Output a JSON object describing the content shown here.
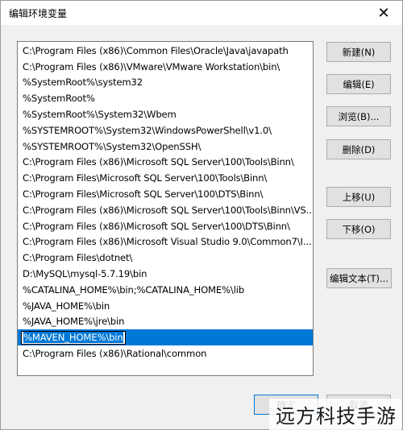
{
  "window": {
    "title": "编辑环境变量",
    "close_glyph": "✕"
  },
  "paths": [
    "C:\\Program Files (x86)\\Common Files\\Oracle\\Java\\javapath",
    "C:\\Program Files (x86)\\VMware\\VMware Workstation\\bin\\",
    "%SystemRoot%\\system32",
    "%SystemRoot%",
    "%SystemRoot%\\System32\\Wbem",
    "%SYSTEMROOT%\\System32\\WindowsPowerShell\\v1.0\\",
    "%SYSTEMROOT%\\System32\\OpenSSH\\",
    "C:\\Program Files (x86)\\Microsoft SQL Server\\100\\Tools\\Binn\\",
    "C:\\Program Files\\Microsoft SQL Server\\100\\Tools\\Binn\\",
    "C:\\Program Files\\Microsoft SQL Server\\100\\DTS\\Binn\\",
    "C:\\Program Files (x86)\\Microsoft SQL Server\\100\\Tools\\Binn\\VS...",
    "C:\\Program Files (x86)\\Microsoft SQL Server\\100\\DTS\\Binn\\",
    "C:\\Program Files (x86)\\Microsoft Visual Studio 9.0\\Common7\\I...",
    "C:\\Program Files\\dotnet\\",
    "D:\\MySQL\\mysql-5.7.19\\bin",
    "%CATALINA_HOME%\\bin;%CATALINA_HOME%\\lib",
    "%JAVA_HOME%\\bin",
    "%JAVA_HOME%\\jre\\bin",
    "%MAVEN_HOME%\\bin",
    "C:\\Program Files (x86)\\Rational\\common"
  ],
  "selected_index": 18,
  "buttons": {
    "new": "新建(N)",
    "edit": "编辑(E)",
    "browse": "浏览(B)...",
    "delete": "删除(D)",
    "move_up": "上移(U)",
    "move_down": "下移(O)",
    "edit_text": "编辑文本(T)..."
  },
  "footer": {
    "ok": "确定",
    "cancel": "取消"
  },
  "watermark": "远方科技手游",
  "colors": {
    "selection": "#0078d7",
    "button_face": "#e1e1e1"
  }
}
